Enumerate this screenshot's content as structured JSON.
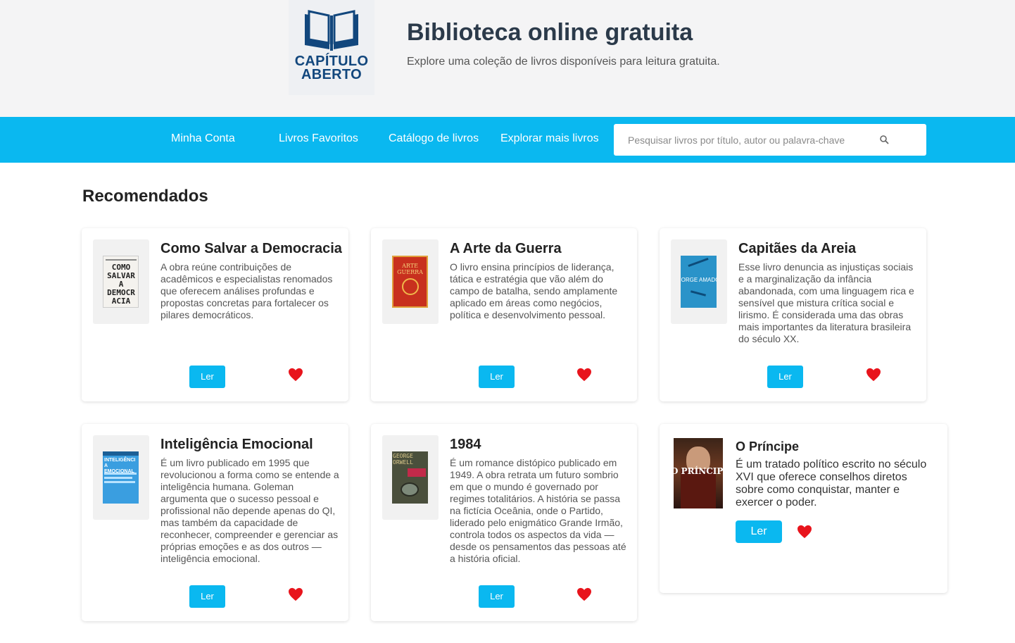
{
  "header": {
    "logo_line1": "CAPÍTULO",
    "logo_line2": "ABERTO",
    "title": "Biblioteca online gratuita",
    "subtitle": "Explore uma coleção de livros disponíveis para leitura gratuita."
  },
  "nav": {
    "items": [
      "Minha Conta",
      "Livros Favoritos",
      "Catálogo de livros",
      "Explorar mais livros"
    ],
    "search_placeholder": "Pesquisar livros por título, autor ou palavra-chave"
  },
  "section_title": "Recomendados",
  "books": [
    {
      "title": "Como Salvar a Democracia",
      "description": "A obra reúne contribuições de acadêmicos e especialistas renomados que oferecem análises profundas e propostas concretas para fortalecer os pilares democráticos.",
      "button": "Ler",
      "cover_text": "COMO SALVAR A DEMOCRACIA"
    },
    {
      "title": "A Arte da Guerra",
      "description": "O livro ensina princípios de liderança, tática e estratégia que vão além do campo de batalha, sendo amplamente aplicado em áreas como negócios, política e desenvolvimento pessoal.",
      "button": "Ler",
      "cover_text": "ARTE GUERRA"
    },
    {
      "title": "Capitães da Areia",
      "description": "Esse livro denuncia as injustiças sociais e a marginalização da infância abandonada, com uma linguagem rica e sensível que mistura crítica social e lirismo. É considerada uma das obras mais importantes da literatura brasileira do século XX.",
      "button": "Ler",
      "cover_text": "JORGE AMADO"
    },
    {
      "title": "Inteligência Emocional",
      "description": "É um livro publicado em 1995 que revolucionou a forma como se entende a inteligência humana. Goleman argumenta que o sucesso pessoal e profissional não depende apenas do QI, mas também da capacidade de reconhecer, compreender e gerenciar as próprias emoções e as dos outros — inteligência emocional.",
      "button": "Ler",
      "cover_text": "INTELIGÊNCIA EMOCIONAL"
    },
    {
      "title": "1984",
      "description": "É um romance distópico publicado em 1949. A obra retrata um futuro sombrio em que o mundo é governado por regimes totalitários. A história se passa na fictícia Oceânia, onde o Partido, liderado pelo enigmático Grande Irmão, controla todos os aspectos da vida — desde os pensamentos das pessoas até a história oficial.",
      "button": "Ler",
      "cover_text": "GEORGE ORWELL"
    },
    {
      "title": "O Príncipe",
      "description": "É um tratado político escrito no século XVI que oferece conselhos diretos sobre como conquistar, manter e exercer o poder.",
      "button": "Ler",
      "cover_text": "O PRÍNCIPE"
    }
  ],
  "colors": {
    "accent": "#0ab8f0",
    "heart": "#e8141c",
    "logo": "#12477d"
  }
}
